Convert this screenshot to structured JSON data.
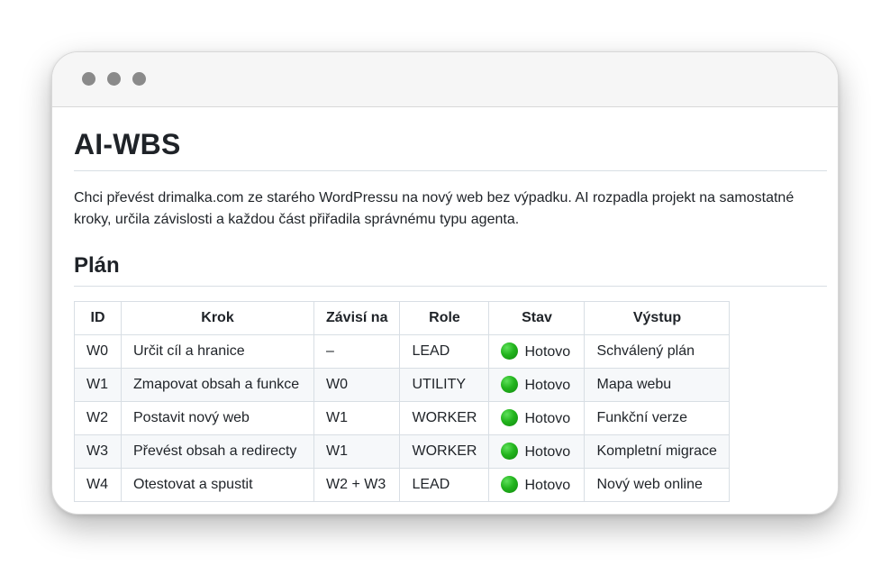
{
  "page": {
    "title": "AI-WBS",
    "intro": "Chci převést drimalka.com ze starého WordPressu na nový web bez výpadku. AI rozpadla projekt na samostatné kroky, určila závislosti a každou část přiřadila správnému typu agenta.",
    "section_title": "Plán"
  },
  "table": {
    "headers": [
      "ID",
      "Krok",
      "Závisí na",
      "Role",
      "Stav",
      "Výstup"
    ],
    "rows": [
      {
        "id": "W0",
        "krok": "Určit cíl a hranice",
        "depends": "–",
        "role": "LEAD",
        "status": "Hotovo",
        "output": "Schválený plán"
      },
      {
        "id": "W1",
        "krok": "Zmapovat obsah a funkce",
        "depends": "W0",
        "role": "UTILITY",
        "status": "Hotovo",
        "output": "Mapa webu"
      },
      {
        "id": "W2",
        "krok": "Postavit nový web",
        "depends": "W1",
        "role": "WORKER",
        "status": "Hotovo",
        "output": "Funkční verze"
      },
      {
        "id": "W3",
        "krok": "Převést obsah a redirecty",
        "depends": "W1",
        "role": "WORKER",
        "status": "Hotovo",
        "output": "Kompletní migrace"
      },
      {
        "id": "W4",
        "krok": "Otestovat a spustit",
        "depends": "W2 + W3",
        "role": "LEAD",
        "status": "Hotovo",
        "output": "Nový web online"
      }
    ]
  },
  "icons": {
    "status": "green-circle-icon",
    "window_controls": [
      "window-dot-icon",
      "window-dot-icon",
      "window-dot-icon"
    ]
  },
  "colors": {
    "status_green": "#22b41d",
    "window_dot": "#8a8a8a"
  }
}
